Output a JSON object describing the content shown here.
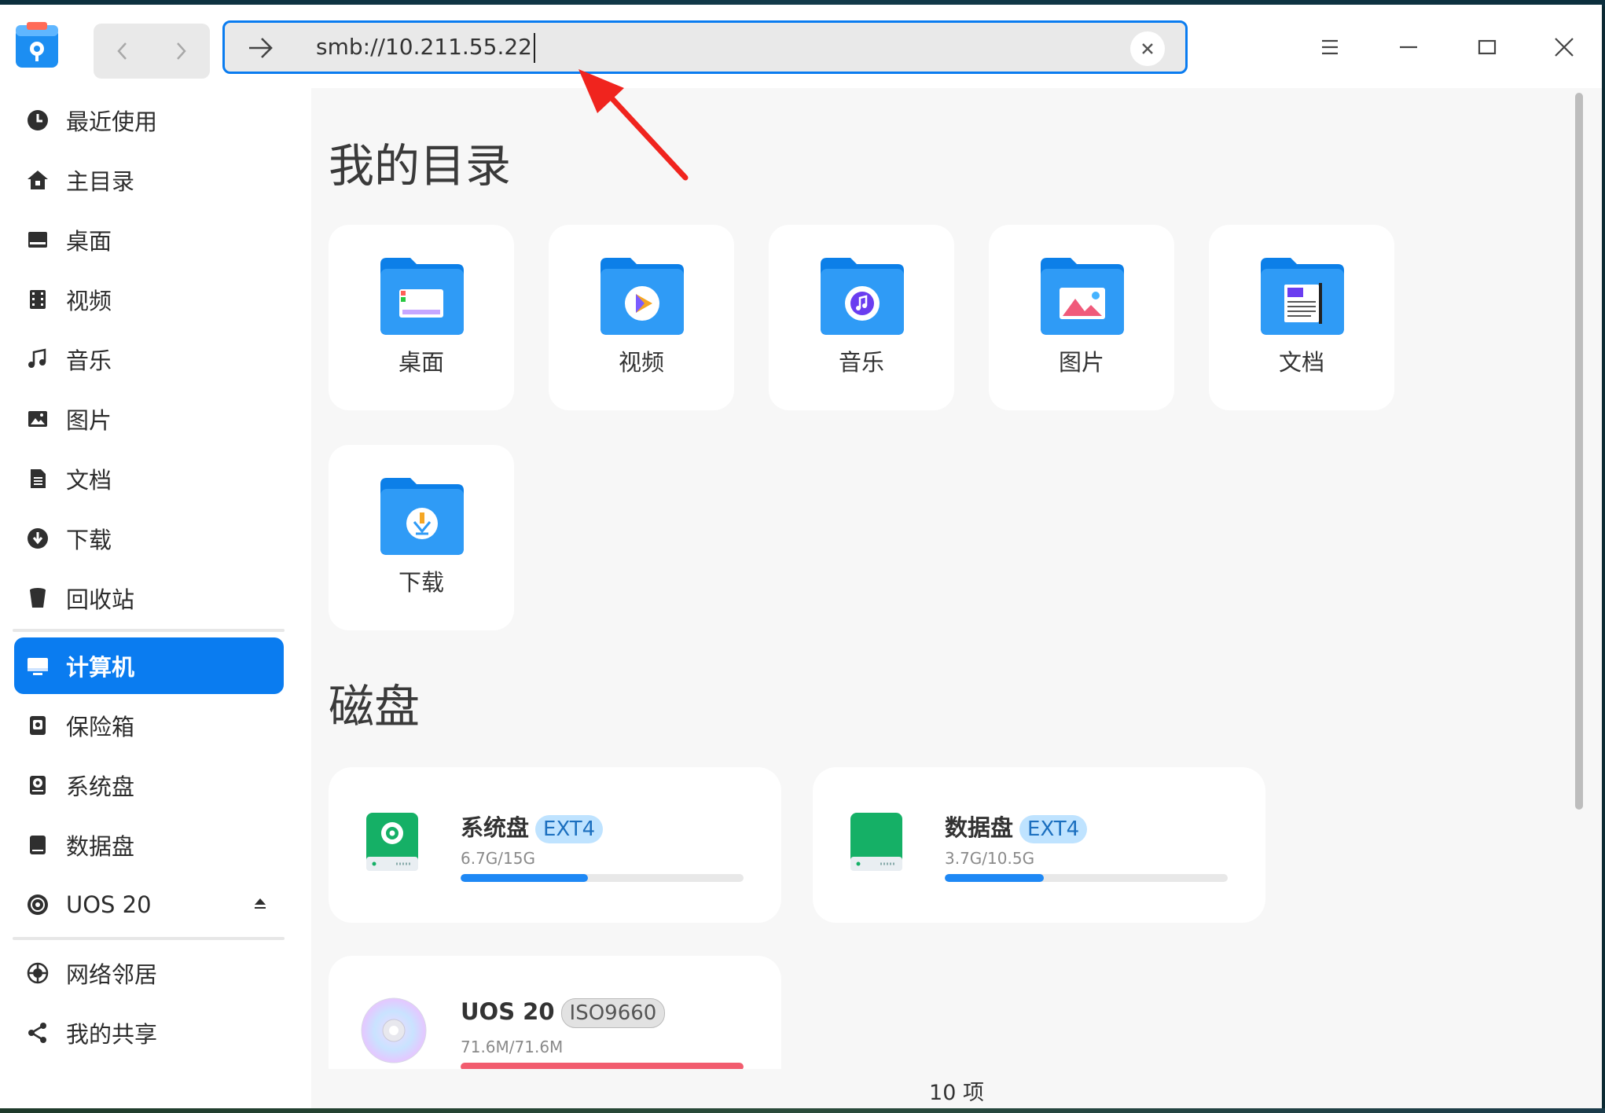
{
  "toolbar": {
    "address_value": "smb://10.211.55.22",
    "clear_symbol": "×"
  },
  "sidebar": {
    "items": [
      {
        "label": "最近使用",
        "icon": "clock-icon"
      },
      {
        "label": "主目录",
        "icon": "home-icon"
      },
      {
        "label": "桌面",
        "icon": "desktop-icon"
      },
      {
        "label": "视频",
        "icon": "film-icon"
      },
      {
        "label": "音乐",
        "icon": "music-note-icon"
      },
      {
        "label": "图片",
        "icon": "image-icon"
      },
      {
        "label": "文档",
        "icon": "document-icon"
      },
      {
        "label": "下载",
        "icon": "download-icon"
      },
      {
        "label": "回收站",
        "icon": "trash-icon"
      },
      {
        "label": "计算机",
        "icon": "computer-icon",
        "active": true
      },
      {
        "label": "保险箱",
        "icon": "vault-icon"
      },
      {
        "label": "系统盘",
        "icon": "system-disk-icon"
      },
      {
        "label": "数据盘",
        "icon": "data-disk-icon"
      },
      {
        "label": "UOS 20",
        "icon": "optical-disc-icon",
        "eject": true
      },
      {
        "label": "网络邻居",
        "icon": "network-icon"
      },
      {
        "label": "我的共享",
        "icon": "share-icon"
      }
    ]
  },
  "main": {
    "my_dirs_title": "我的目录",
    "dirs": [
      {
        "label": "桌面",
        "icon": "desktop-folder-icon"
      },
      {
        "label": "视频",
        "icon": "video-folder-icon"
      },
      {
        "label": "音乐",
        "icon": "music-folder-icon"
      },
      {
        "label": "图片",
        "icon": "pictures-folder-icon"
      },
      {
        "label": "文档",
        "icon": "documents-folder-icon"
      },
      {
        "label": "下载",
        "icon": "downloads-folder-icon"
      }
    ],
    "disks_title": "磁盘",
    "disks": [
      {
        "name": "系统盘",
        "fs": "EXT4",
        "size": "6.7G/15G",
        "usage": 0.45,
        "color": "#1e88f5"
      },
      {
        "name": "数据盘",
        "fs": "EXT4",
        "size": "3.7G/10.5G",
        "usage": 0.35,
        "color": "#1e88f5"
      },
      {
        "name": "UOS 20",
        "fs": "ISO9660",
        "size": "71.6M/71.6M",
        "usage": 1.0,
        "color": "#f25c6e"
      }
    ]
  },
  "status": {
    "item_count": "10 项"
  },
  "colors": {
    "accent": "#0a7cf0",
    "annotation_arrow": "#f0241e"
  }
}
